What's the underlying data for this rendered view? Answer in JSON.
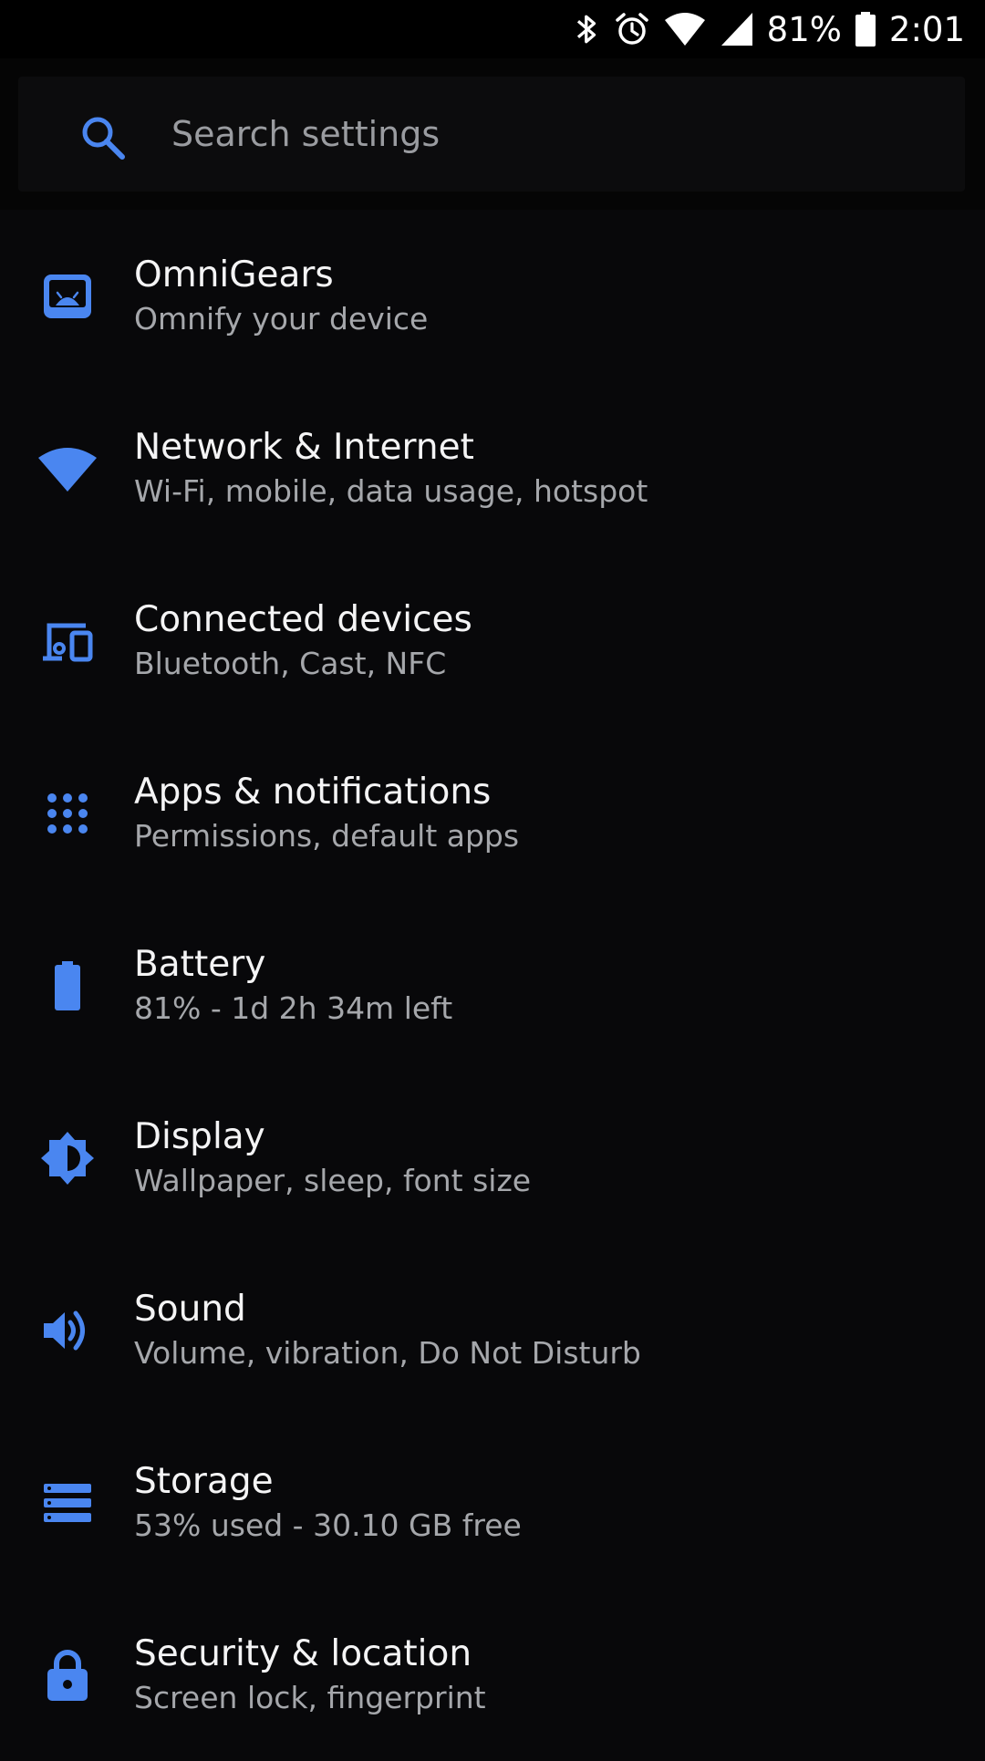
{
  "status_bar": {
    "battery_percent": "81%",
    "time": "2:01",
    "icons": [
      "bluetooth-icon",
      "alarm-icon",
      "wifi-icon",
      "cell-signal-icon",
      "battery-icon"
    ]
  },
  "search": {
    "placeholder": "Search settings"
  },
  "colors": {
    "accent": "#4a86f0",
    "background": "#08080a",
    "title": "#f4f4f5",
    "subtitle": "#a5a7ab"
  },
  "settings": [
    {
      "title": "OmniGears",
      "subtitle": "Omnify your device",
      "icon": "omnigears-icon"
    },
    {
      "title": "Network & Internet",
      "subtitle": "Wi-Fi, mobile, data usage, hotspot",
      "icon": "wifi-icon"
    },
    {
      "title": "Connected devices",
      "subtitle": "Bluetooth, Cast, NFC",
      "icon": "devices-icon"
    },
    {
      "title": "Apps & notifications",
      "subtitle": "Permissions, default apps",
      "icon": "apps-icon"
    },
    {
      "title": "Battery",
      "subtitle": "81% - 1d 2h 34m left",
      "icon": "battery-icon"
    },
    {
      "title": "Display",
      "subtitle": "Wallpaper, sleep, font size",
      "icon": "brightness-icon"
    },
    {
      "title": "Sound",
      "subtitle": "Volume, vibration, Do Not Disturb",
      "icon": "volume-icon"
    },
    {
      "title": "Storage",
      "subtitle": "53% used - 30.10 GB free",
      "icon": "storage-icon"
    },
    {
      "title": "Security & location",
      "subtitle": "Screen lock, fingerprint",
      "icon": "lock-icon"
    }
  ]
}
